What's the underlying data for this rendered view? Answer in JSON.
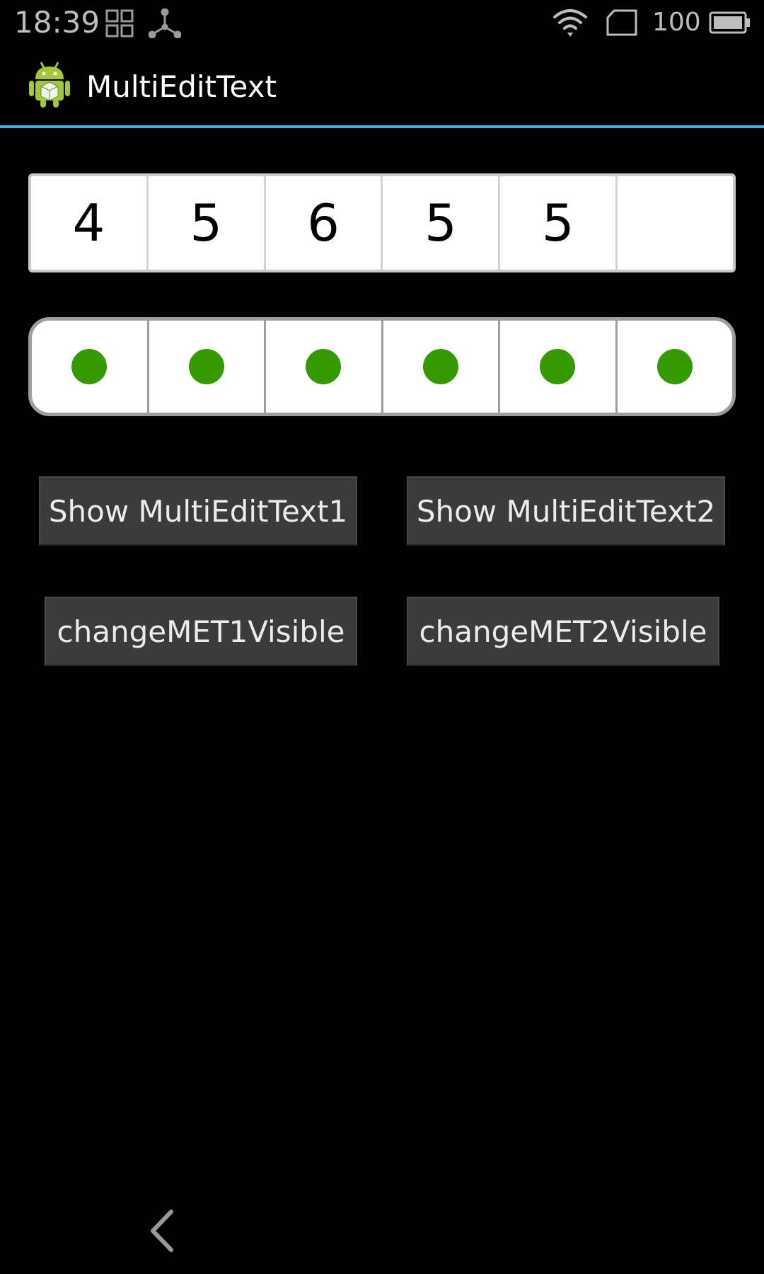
{
  "status_bar": {
    "time": "18:39",
    "battery_level": "100",
    "icons": [
      "gallery-grid-icon",
      "network-share-icon",
      "wifi-icon",
      "sim-card-icon",
      "battery-icon"
    ]
  },
  "action_bar": {
    "title": "MultiEditText",
    "icon": "android-icon",
    "divider_color": "#33b5e5"
  },
  "met1": {
    "cells": [
      "4",
      "5",
      "6",
      "5",
      "5",
      ""
    ]
  },
  "met2": {
    "cell_count": 6,
    "dot_color": "#349a00",
    "cell_glyph": "dot"
  },
  "buttons": {
    "show_met1": "Show MultiEditText1",
    "show_met2": "Show MultiEditText2",
    "change_met1": "changeMET1Visible",
    "change_met2": "changeMET2Visible"
  },
  "nav": {
    "back_icon": "back-chevron-icon"
  }
}
